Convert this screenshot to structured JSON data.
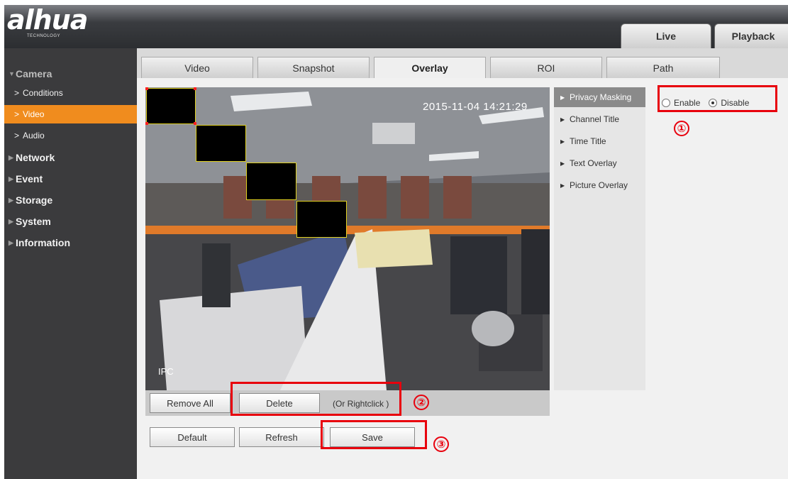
{
  "header": {
    "logo_text": "alhua",
    "logo_tagline": "TECHNOLOGY",
    "tabs": [
      {
        "label": "Live"
      },
      {
        "label": "Playback"
      }
    ]
  },
  "sidebar": {
    "categories": [
      {
        "label": "Camera",
        "expanded": true,
        "items": [
          {
            "label": "Conditions"
          },
          {
            "label": "Video",
            "active": true
          },
          {
            "label": "Audio"
          }
        ]
      },
      {
        "label": "Network"
      },
      {
        "label": "Event"
      },
      {
        "label": "Storage"
      },
      {
        "label": "System"
      },
      {
        "label": "Information"
      }
    ],
    "active_color": "#f08c1e"
  },
  "subtabs": [
    {
      "label": "Video"
    },
    {
      "label": "Snapshot"
    },
    {
      "label": "Overlay",
      "active": true
    },
    {
      "label": "ROI"
    },
    {
      "label": "Path"
    }
  ],
  "video": {
    "timestamp": "2015-11-04 14:21:29",
    "camera_label": "IPC",
    "mask_count": 4
  },
  "toolbar": {
    "remove_all": "Remove All",
    "delete": "Delete",
    "hint": "(Or Rightclick )"
  },
  "overlay_menu": [
    {
      "label": "Privacy Masking",
      "active": true
    },
    {
      "label": "Channel Title"
    },
    {
      "label": "Time Title"
    },
    {
      "label": "Text Overlay"
    },
    {
      "label": "Picture Overlay"
    }
  ],
  "privacy": {
    "enable_label": "Enable",
    "disable_label": "Disable",
    "selected": "Disable"
  },
  "actions": {
    "default": "Default",
    "refresh": "Refresh",
    "save": "Save"
  },
  "annotations": {
    "marker_1": "①",
    "marker_2": "②",
    "marker_3": "③",
    "color": "#e8000d"
  }
}
